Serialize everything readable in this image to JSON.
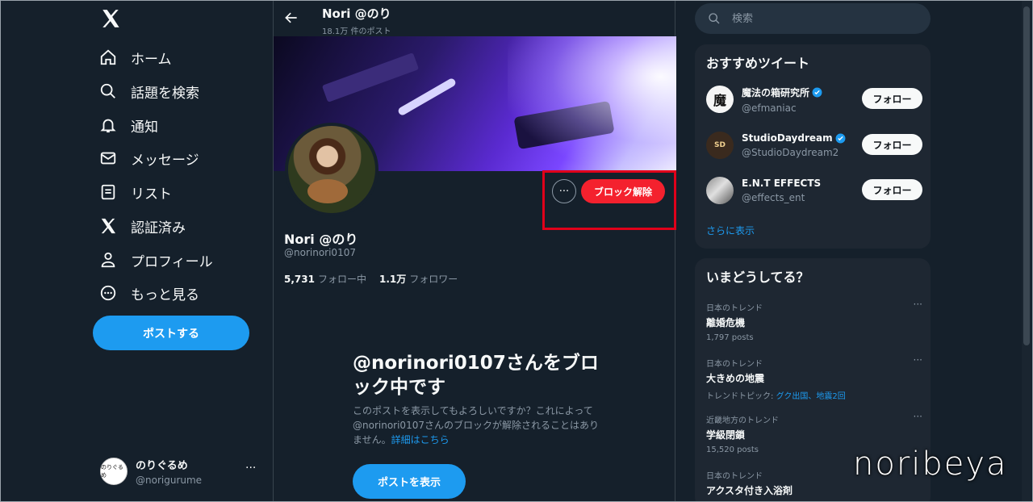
{
  "sidebar": {
    "logo": "x-logo-icon",
    "items": [
      {
        "label": "ホーム",
        "icon": "home-icon"
      },
      {
        "label": "話題を検索",
        "icon": "search-icon"
      },
      {
        "label": "通知",
        "icon": "bell-icon"
      },
      {
        "label": "メッセージ",
        "icon": "mail-icon"
      },
      {
        "label": "リスト",
        "icon": "list-icon"
      },
      {
        "label": "認証済み",
        "icon": "x-verified-icon"
      },
      {
        "label": "プロフィール",
        "icon": "person-icon"
      },
      {
        "label": "もっと見る",
        "icon": "more-circle-icon"
      }
    ],
    "post_button": "ポストする",
    "account": {
      "name": "のりぐるめ",
      "handle": "@norigurume",
      "avatar_text": "のりぐるめ",
      "more": "···"
    }
  },
  "topbar": {
    "name": "Nori @のり",
    "post_count": "18.1万 件のポスト"
  },
  "profile": {
    "name": "Nori @のり",
    "handle": "@norinori0107",
    "following_count": "5,731",
    "following_label": "フォロー中",
    "followers_count": "1.1万",
    "followers_label": "フォロワー",
    "more_button": "···",
    "unblock_button": "ブロック解除"
  },
  "blocked": {
    "title": "@norinori0107さんをブロック中です",
    "description": "このポストを表示してもよろしいですか？これによって@norinori0107さんのブロックが解除されることはありません。",
    "link": "詳細はこちら",
    "view_button": "ポストを表示"
  },
  "search": {
    "placeholder": "検索"
  },
  "recommended": {
    "title": "おすすめツイート",
    "items": [
      {
        "name": "魔法の箱研究所",
        "handle": "@efmaniac",
        "follow": "フォロー",
        "avatar_text": "魔",
        "verified": true
      },
      {
        "name": "StudioDaydream",
        "handle": "@StudioDaydream2",
        "follow": "フォロー",
        "avatar_text": "SD",
        "verified": true
      },
      {
        "name": "E.N.T EFFECTS",
        "handle": "@effects_ent",
        "follow": "フォロー",
        "avatar_text": "",
        "verified": false
      }
    ],
    "show_more": "さらに表示"
  },
  "trends": {
    "title": "いまどうしてる？",
    "items": [
      {
        "meta": "日本のトレンド",
        "title": "離婚危機",
        "sub": "1,797 posts",
        "sub_prefix": "",
        "sub_highlight": ""
      },
      {
        "meta": "日本のトレンド",
        "title": "大きめの地震",
        "sub": "",
        "sub_prefix": "トレンドトピック:",
        "sub_highlight": "グク出国、地震2回"
      },
      {
        "meta": "近畿地方のトレンド",
        "title": "学級閉鎖",
        "sub": "15,520 posts",
        "sub_prefix": "",
        "sub_highlight": ""
      },
      {
        "meta": "日本のトレンド",
        "title": "アクスタ付き入浴剤",
        "sub": "",
        "sub_prefix": "",
        "sub_highlight": ""
      }
    ],
    "more": "···"
  },
  "watermark": "noribeya",
  "colors": {
    "background": "#15202b",
    "accent": "#1d9bf0",
    "unblock": "#f4212e",
    "highlight_box": "#e0001a"
  }
}
